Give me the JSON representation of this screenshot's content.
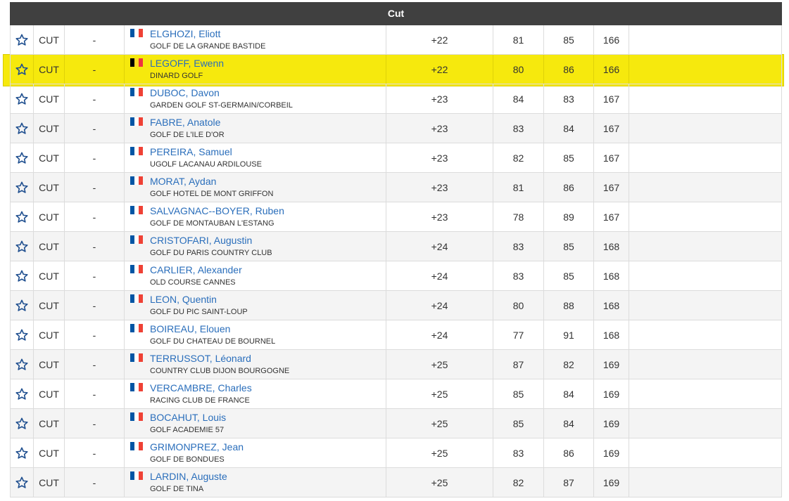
{
  "section": {
    "title": "Cut"
  },
  "colors": {
    "header_bg": "#404040",
    "link": "#2a6ebb",
    "highlight": "#f5e800",
    "alt_row": "#f4f4f4"
  },
  "highlighted_row_index": 1,
  "rows": [
    {
      "pos": "CUT",
      "move": "-",
      "flag": "france",
      "name": "ELGHOZI, Eliott",
      "club": "GOLF DE LA GRANDE BASTIDE",
      "par": "+22",
      "r1": "81",
      "r2": "85",
      "total": "166"
    },
    {
      "pos": "CUT",
      "move": "-",
      "flag": "belgium",
      "name": "LEGOFF, Ewenn",
      "club": "DINARD GOLF",
      "par": "+22",
      "r1": "80",
      "r2": "86",
      "total": "166"
    },
    {
      "pos": "CUT",
      "move": "-",
      "flag": "france",
      "name": "DUBOC, Davon",
      "club": "GARDEN GOLF ST-GERMAIN/CORBEIL",
      "par": "+23",
      "r1": "84",
      "r2": "83",
      "total": "167"
    },
    {
      "pos": "CUT",
      "move": "-",
      "flag": "france",
      "name": "FABRE, Anatole",
      "club": "GOLF DE L'ILE D'OR",
      "par": "+23",
      "r1": "83",
      "r2": "84",
      "total": "167"
    },
    {
      "pos": "CUT",
      "move": "-",
      "flag": "france",
      "name": "PEREIRA, Samuel",
      "club": "UGOLF LACANAU ARDILOUSE",
      "par": "+23",
      "r1": "82",
      "r2": "85",
      "total": "167"
    },
    {
      "pos": "CUT",
      "move": "-",
      "flag": "france",
      "name": "MORAT, Aydan",
      "club": "GOLF HOTEL DE MONT GRIFFON",
      "par": "+23",
      "r1": "81",
      "r2": "86",
      "total": "167"
    },
    {
      "pos": "CUT",
      "move": "-",
      "flag": "france",
      "name": "SALVAGNAC--BOYER, Ruben",
      "club": "GOLF DE MONTAUBAN L'ESTANG",
      "par": "+23",
      "r1": "78",
      "r2": "89",
      "total": "167"
    },
    {
      "pos": "CUT",
      "move": "-",
      "flag": "france",
      "name": "CRISTOFARI, Augustin",
      "club": "GOLF DU PARIS COUNTRY CLUB",
      "par": "+24",
      "r1": "83",
      "r2": "85",
      "total": "168"
    },
    {
      "pos": "CUT",
      "move": "-",
      "flag": "france",
      "name": "CARLIER, Alexander",
      "club": "OLD COURSE CANNES",
      "par": "+24",
      "r1": "83",
      "r2": "85",
      "total": "168"
    },
    {
      "pos": "CUT",
      "move": "-",
      "flag": "france",
      "name": "LEON, Quentin",
      "club": "GOLF DU PIC SAINT-LOUP",
      "par": "+24",
      "r1": "80",
      "r2": "88",
      "total": "168"
    },
    {
      "pos": "CUT",
      "move": "-",
      "flag": "france",
      "name": "BOIREAU, Elouen",
      "club": "GOLF DU CHATEAU DE BOURNEL",
      "par": "+24",
      "r1": "77",
      "r2": "91",
      "total": "168"
    },
    {
      "pos": "CUT",
      "move": "-",
      "flag": "france",
      "name": "TERRUSSOT, Léonard",
      "club": "COUNTRY CLUB DIJON BOURGOGNE",
      "par": "+25",
      "r1": "87",
      "r2": "82",
      "total": "169"
    },
    {
      "pos": "CUT",
      "move": "-",
      "flag": "france",
      "name": "VERCAMBRE, Charles",
      "club": "RACING CLUB DE FRANCE",
      "par": "+25",
      "r1": "85",
      "r2": "84",
      "total": "169"
    },
    {
      "pos": "CUT",
      "move": "-",
      "flag": "france",
      "name": "BOCAHUT, Louis",
      "club": "GOLF ACADEMIE 57",
      "par": "+25",
      "r1": "85",
      "r2": "84",
      "total": "169"
    },
    {
      "pos": "CUT",
      "move": "-",
      "flag": "france",
      "name": "GRIMONPREZ, Jean",
      "club": "GOLF DE BONDUES",
      "par": "+25",
      "r1": "83",
      "r2": "86",
      "total": "169"
    },
    {
      "pos": "CUT",
      "move": "-",
      "flag": "france",
      "name": "LARDIN, Auguste",
      "club": "GOLF DE TINA",
      "par": "+25",
      "r1": "82",
      "r2": "87",
      "total": "169"
    }
  ]
}
